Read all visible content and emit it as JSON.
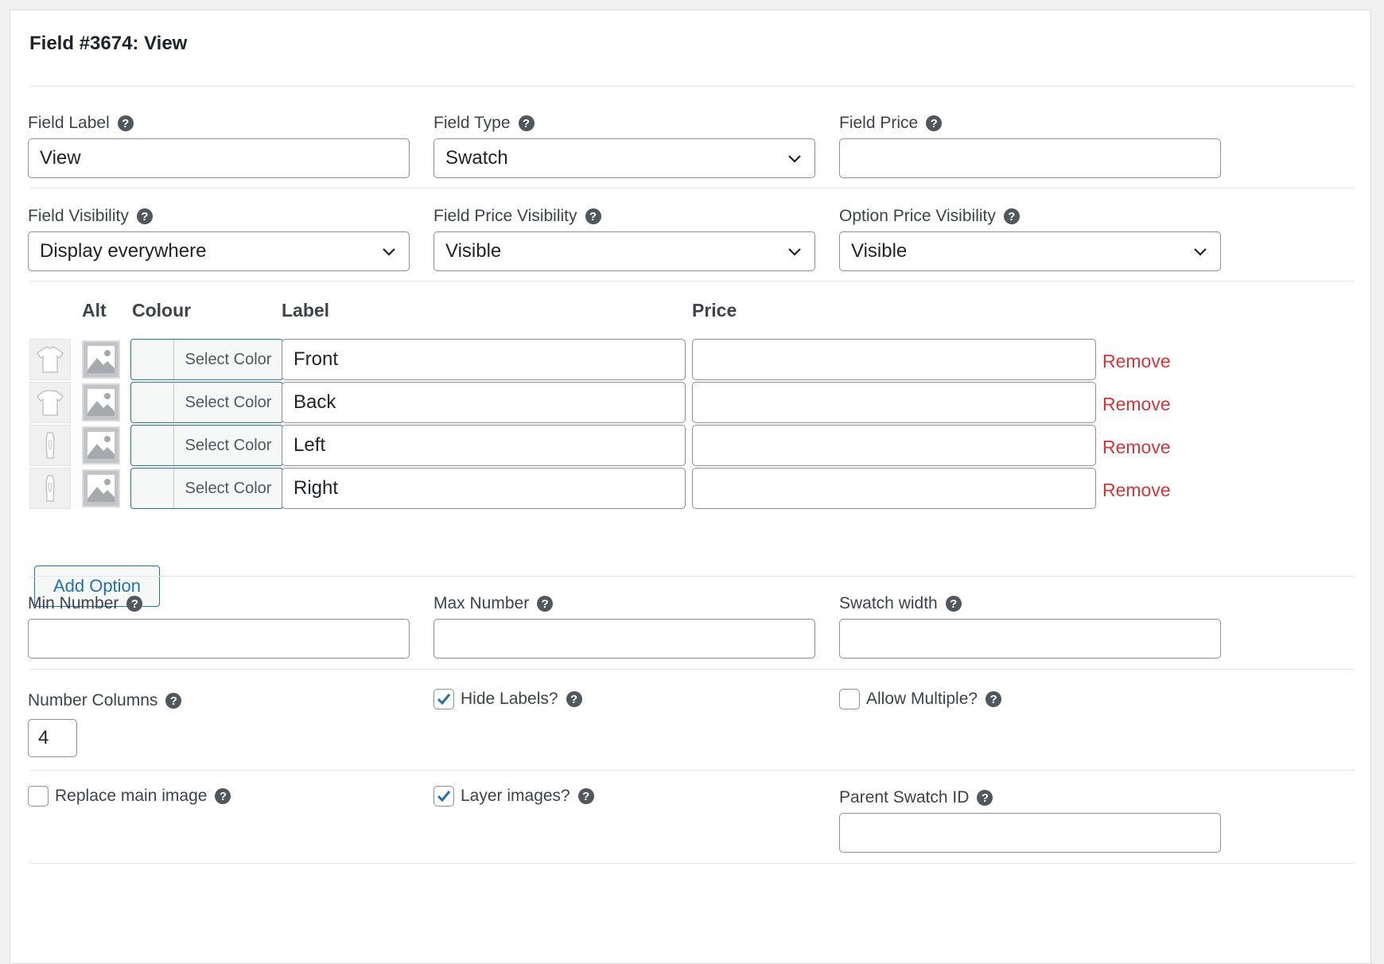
{
  "title": "Field #3674: View",
  "help_glyph": "?",
  "row1": {
    "field_label": {
      "label": "Field Label",
      "value": "View"
    },
    "field_type": {
      "label": "Field Type",
      "value": "Swatch"
    },
    "field_price": {
      "label": "Field Price",
      "value": ""
    }
  },
  "row2": {
    "field_visibility": {
      "label": "Field Visibility",
      "value": "Display everywhere"
    },
    "field_price_visibility": {
      "label": "Field Price Visibility",
      "value": "Visible"
    },
    "option_price_visibility": {
      "label": "Option Price Visibility",
      "value": "Visible"
    }
  },
  "options_table": {
    "headers": {
      "alt": "Alt",
      "colour": "Colour",
      "label": "Label",
      "price": "Price"
    },
    "select_color_label": "Select Color",
    "remove_label": "Remove",
    "rows": [
      {
        "label": "Front",
        "price": "",
        "thumb_icon": "tshirt-front-icon"
      },
      {
        "label": "Back",
        "price": "",
        "thumb_icon": "tshirt-back-icon"
      },
      {
        "label": "Left",
        "price": "",
        "thumb_icon": "tshirt-left-icon"
      },
      {
        "label": "Right",
        "price": "",
        "thumb_icon": "tshirt-right-icon"
      }
    ],
    "add_option_label": "Add Option"
  },
  "row3": {
    "min_number": {
      "label": "Min Number",
      "value": ""
    },
    "max_number": {
      "label": "Max Number",
      "value": ""
    },
    "swatch_width": {
      "label": "Swatch width",
      "value": ""
    }
  },
  "row4": {
    "number_columns": {
      "label": "Number Columns",
      "value": "4"
    },
    "hide_labels": {
      "label": "Hide Labels?",
      "checked": true
    },
    "allow_multiple": {
      "label": "Allow Multiple?",
      "checked": false
    }
  },
  "row5": {
    "replace_main_image": {
      "label": "Replace main image",
      "checked": false
    },
    "layer_images": {
      "label": "Layer images?",
      "checked": true
    },
    "parent_swatch_id": {
      "label": "Parent Swatch ID",
      "value": ""
    }
  },
  "colors": {
    "accent": "#2271b1",
    "remove": "#d63638",
    "border": "#8c8f94"
  }
}
